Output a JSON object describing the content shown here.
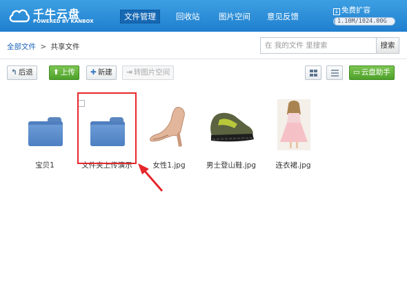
{
  "header": {
    "brand_title": "千牛云盘",
    "brand_subtitle": "POWERED BY KANBOX",
    "nav": [
      {
        "label": "文件管理",
        "active": true
      },
      {
        "label": "回收站",
        "active": false
      },
      {
        "label": "图片空间",
        "active": false
      },
      {
        "label": "意见反馈",
        "active": false
      }
    ],
    "expand_label": "免费扩容",
    "quota_text": "1.10M/1024.00G",
    "quota_fraction": 0.001
  },
  "breadcrumb": {
    "root": "全部文件",
    "separator": ">",
    "current": "共享文件"
  },
  "search": {
    "placeholder": "在 我的文件 里搜索",
    "button": "搜索"
  },
  "toolbar": {
    "back": "后退",
    "upload": "上传",
    "new": "新建",
    "to_image_space": "转图片空间",
    "assistant": "云盘助手"
  },
  "files": [
    {
      "name": "宝贝1",
      "type": "folder"
    },
    {
      "name": "文件夹上传演示",
      "type": "folder",
      "selected": true
    },
    {
      "name": "女性1.jpg",
      "type": "image",
      "icon": "high-heel-shoe-thumbnail"
    },
    {
      "name": "男士登山鞋.jpg",
      "type": "image",
      "icon": "hiking-shoe-thumbnail"
    },
    {
      "name": "连衣裙.jpg",
      "type": "image",
      "icon": "dress-thumbnail"
    }
  ],
  "colors": {
    "header_blue": "#2a8ad8",
    "nav_active": "#1668b3",
    "green": "#5aad33",
    "highlight_red": "#e5262b"
  }
}
